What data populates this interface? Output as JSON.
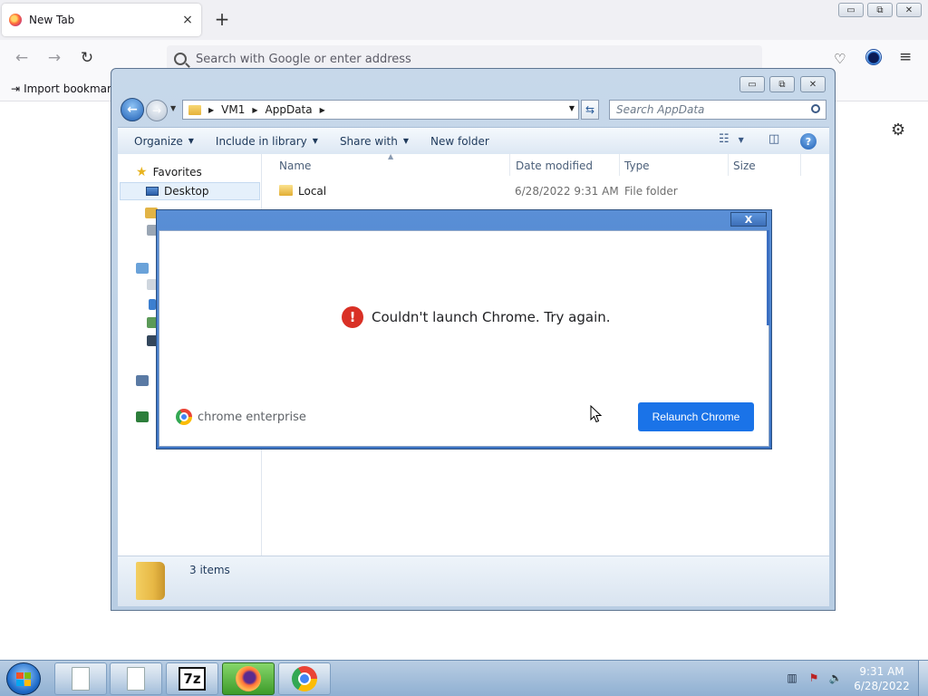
{
  "firefox": {
    "tab_title": "New Tab",
    "tab_close": "×",
    "new_tab": "+",
    "back": "←",
    "forward": "→",
    "reload": "↻",
    "url_placeholder": "Search with Google or enter address",
    "bookmark_import": "Import bookmarks…",
    "pocket_glyph": "♡",
    "menu_glyph": "≡",
    "settings_glyph": "⚙"
  },
  "os_buttons": {
    "minimize": "▭",
    "restore": "⧉",
    "close": "✕"
  },
  "explorer": {
    "back": "←",
    "forward": "→",
    "breadcrumb": [
      "VM1",
      "AppData"
    ],
    "refresh": "⇆",
    "search_placeholder": "Search AppData",
    "toolbar": {
      "organize": "Organize",
      "include_in_library": "Include in library",
      "share_with": "Share with",
      "new_folder": "New folder",
      "view_glyph": "☷",
      "pane_glyph": "◫",
      "help": "?"
    },
    "nav": {
      "favorites": "Favorites",
      "desktop": "Desktop"
    },
    "columns": {
      "name": "Name",
      "date_modified": "Date modified",
      "type": "Type",
      "size": "Size"
    },
    "files": [
      {
        "name": "Local",
        "date": "6/28/2022 9:31 AM",
        "type": "File folder"
      }
    ],
    "status": "3 items"
  },
  "dialog": {
    "close": "X",
    "error_glyph": "!",
    "message": "Couldn't launch Chrome. Try again.",
    "brand": "chrome enterprise",
    "button": "Relaunch Chrome"
  },
  "taskbar": {
    "sevenzip_label": "7z",
    "clock_time": "9:31 AM",
    "clock_date": "6/28/2022"
  }
}
